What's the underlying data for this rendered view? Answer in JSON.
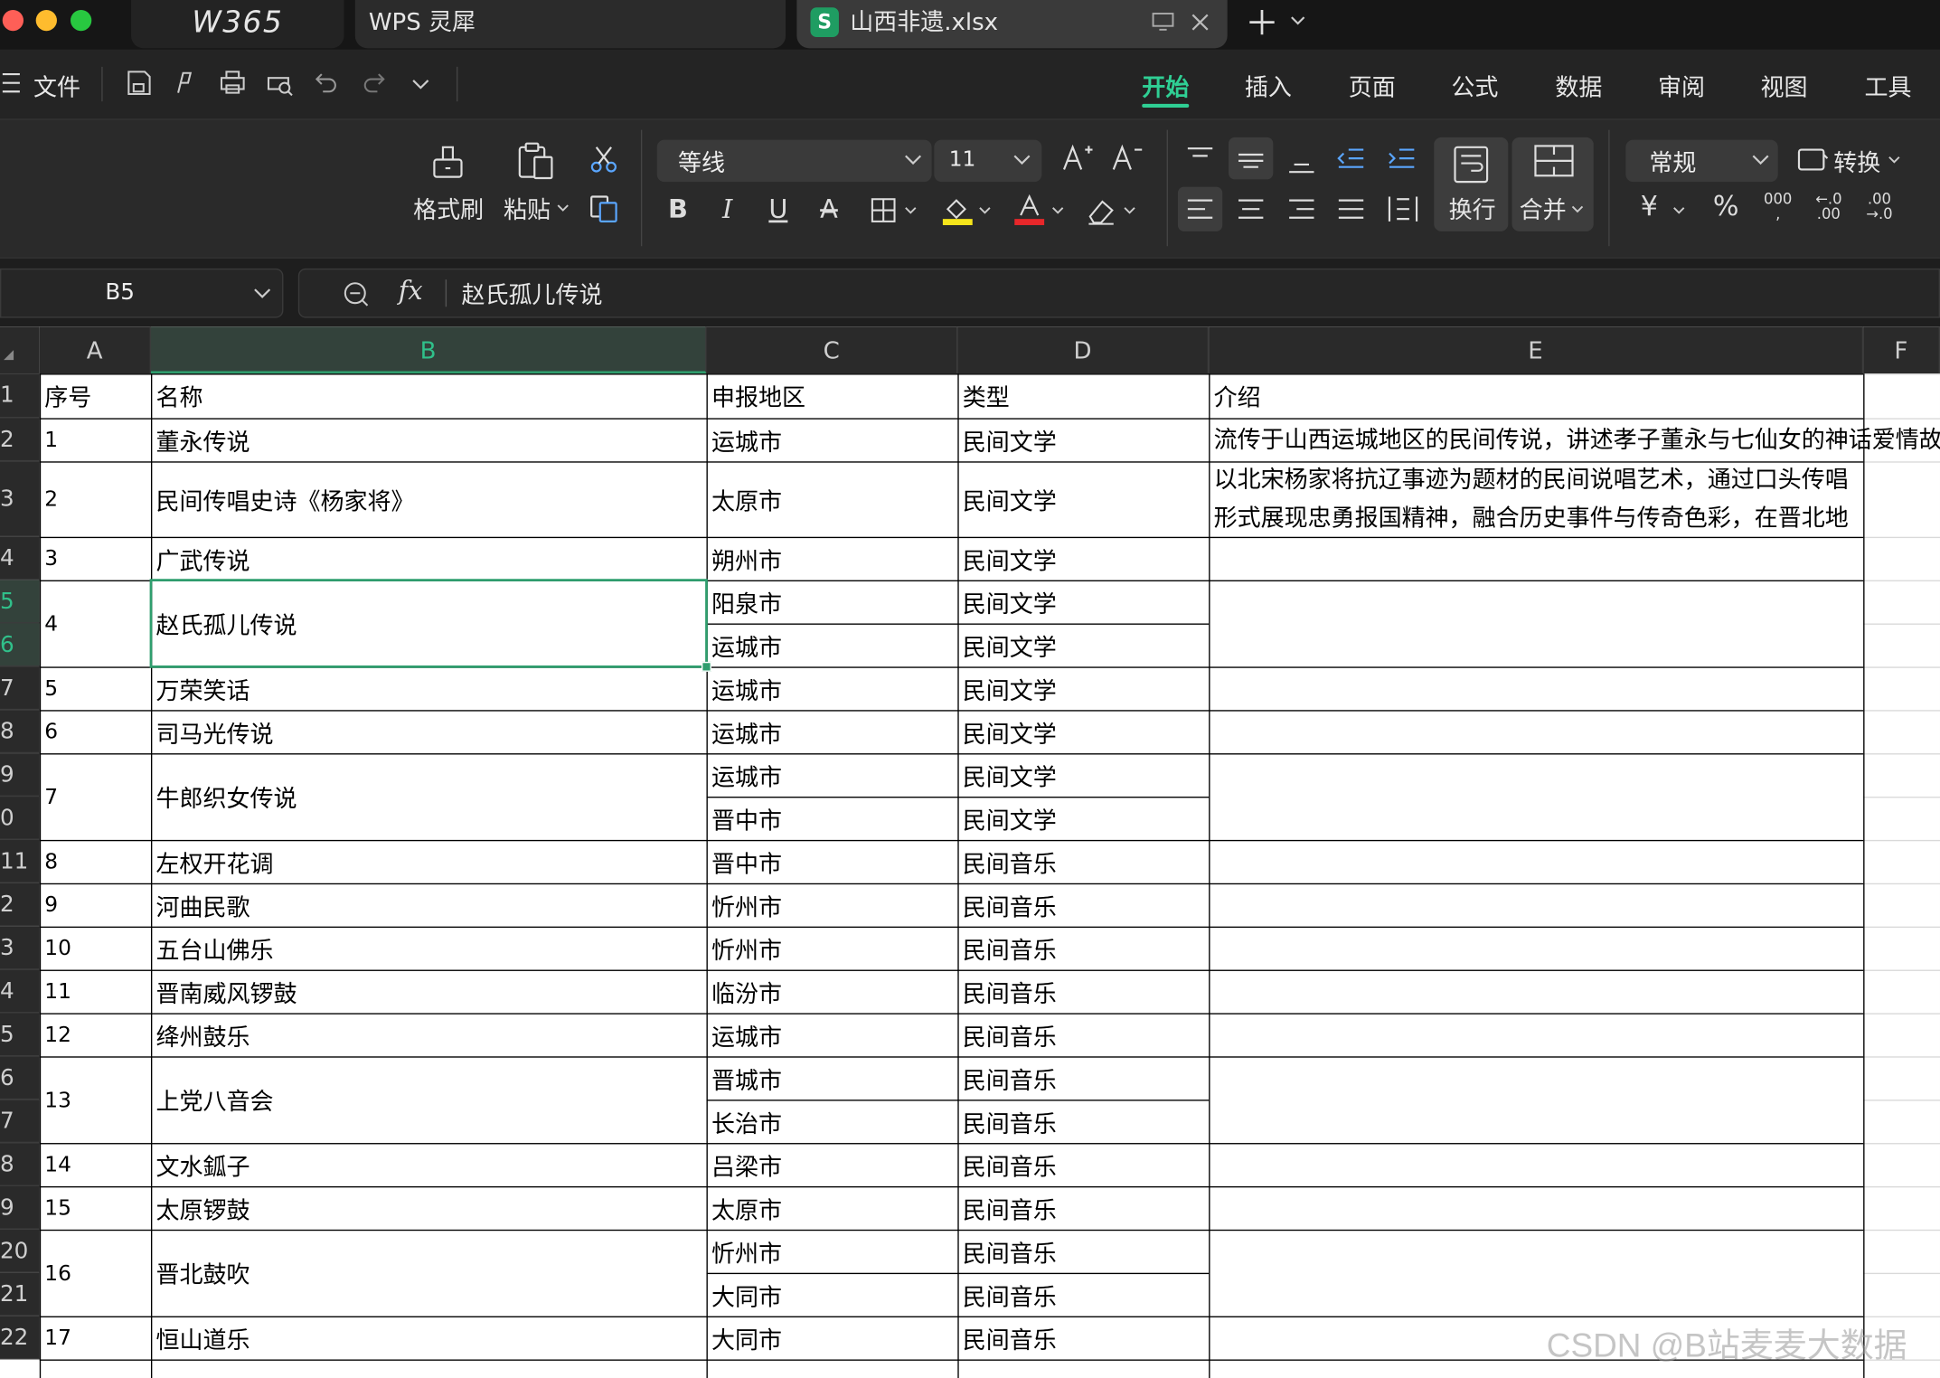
{
  "window": {
    "brand": "W365",
    "tabs": [
      {
        "label": "WPS 灵犀"
      },
      {
        "label": "山西非遗.xlsx",
        "badge": "S"
      }
    ]
  },
  "quickbar": {
    "file_menu": "文件"
  },
  "menu_tabs": [
    "开始",
    "插入",
    "页面",
    "公式",
    "数据",
    "审阅",
    "视图",
    "工具"
  ],
  "active_tab": "开始",
  "ribbon": {
    "format_painter": "格式刷",
    "paste": "粘贴",
    "font_name": "等线",
    "font_size": "11",
    "wrap": "换行",
    "merge": "合并",
    "number_format": "常规",
    "convert": "转换"
  },
  "formula_bar": {
    "cell_ref": "B5",
    "fx": "fx",
    "content": "赵氏孤儿传说"
  },
  "columns": [
    "A",
    "B",
    "C",
    "D",
    "E",
    "F"
  ],
  "row_numbers": [
    "1",
    "2",
    "3",
    "4",
    "5",
    "6",
    "7",
    "8",
    "9",
    "0",
    "11",
    "2",
    "3",
    "4",
    "5",
    "6",
    "7",
    "8",
    "9",
    "20",
    "21",
    "22"
  ],
  "header_row": [
    "序号",
    "名称",
    "申报地区",
    "类型",
    "介绍"
  ],
  "items": [
    {
      "id": "1",
      "name": "董永传说",
      "regions": [
        "运城市"
      ],
      "type": [
        "民间文学"
      ],
      "intro": [
        "流传于山西运城地区的民间传说，讲述孝子董永与七仙女的神话爱情故"
      ]
    },
    {
      "id": "2",
      "name": "民间传唱史诗《杨家将》",
      "regions": [
        "太原市"
      ],
      "type": [
        "民间文学"
      ],
      "intro": [
        "以北宋杨家将抗辽事迹为题材的民间说唱艺术，通过口头传唱",
        "形式展现忠勇报国精神，融合历史事件与传奇色彩，在晋北地"
      ]
    },
    {
      "id": "3",
      "name": "广武传说",
      "regions": [
        "朔州市"
      ],
      "type": [
        "民间文学"
      ],
      "intro": []
    },
    {
      "id": "4",
      "name": "赵氏孤儿传说",
      "regions": [
        "阳泉市",
        "运城市"
      ],
      "type": [
        "民间文学",
        "民间文学"
      ],
      "intro": []
    },
    {
      "id": "5",
      "name": "万荣笑话",
      "regions": [
        "运城市"
      ],
      "type": [
        "民间文学"
      ],
      "intro": []
    },
    {
      "id": "6",
      "name": "司马光传说",
      "regions": [
        "运城市"
      ],
      "type": [
        "民间文学"
      ],
      "intro": []
    },
    {
      "id": "7",
      "name": "牛郎织女传说",
      "regions": [
        "运城市",
        "晋中市"
      ],
      "type": [
        "民间文学",
        "民间文学"
      ],
      "intro": []
    },
    {
      "id": "8",
      "name": "左权开花调",
      "regions": [
        "晋中市"
      ],
      "type": [
        "民间音乐"
      ],
      "intro": []
    },
    {
      "id": "9",
      "name": "河曲民歌",
      "regions": [
        "忻州市"
      ],
      "type": [
        "民间音乐"
      ],
      "intro": []
    },
    {
      "id": "10",
      "name": "五台山佛乐",
      "regions": [
        "忻州市"
      ],
      "type": [
        "民间音乐"
      ],
      "intro": []
    },
    {
      "id": "11",
      "name": "晋南威风锣鼓",
      "regions": [
        "临汾市"
      ],
      "type": [
        "民间音乐"
      ],
      "intro": []
    },
    {
      "id": "12",
      "name": "绛州鼓乐",
      "regions": [
        "运城市"
      ],
      "type": [
        "民间音乐"
      ],
      "intro": []
    },
    {
      "id": "13",
      "name": "上党八音会",
      "regions": [
        "晋城市",
        "长治市"
      ],
      "type": [
        "民间音乐",
        "民间音乐"
      ],
      "intro": []
    },
    {
      "id": "14",
      "name": "文水鈲子",
      "regions": [
        "吕梁市"
      ],
      "type": [
        "民间音乐"
      ],
      "intro": []
    },
    {
      "id": "15",
      "name": "太原锣鼓",
      "regions": [
        "太原市"
      ],
      "type": [
        "民间音乐"
      ],
      "intro": []
    },
    {
      "id": "16",
      "name": "晋北鼓吹",
      "regions": [
        "忻州市",
        "大同市"
      ],
      "type": [
        "民间音乐",
        "民间音乐"
      ],
      "intro": []
    },
    {
      "id": "17",
      "name": "恒山道乐",
      "regions": [
        "大同市"
      ],
      "type": [
        "民间音乐"
      ],
      "intro": []
    }
  ],
  "watermark": "CSDN @B站麦麦大数据",
  "colors": {
    "accent": "#27a97a",
    "selection": "#2f9e6e",
    "ribbon_bg": "#2a2a2a"
  }
}
